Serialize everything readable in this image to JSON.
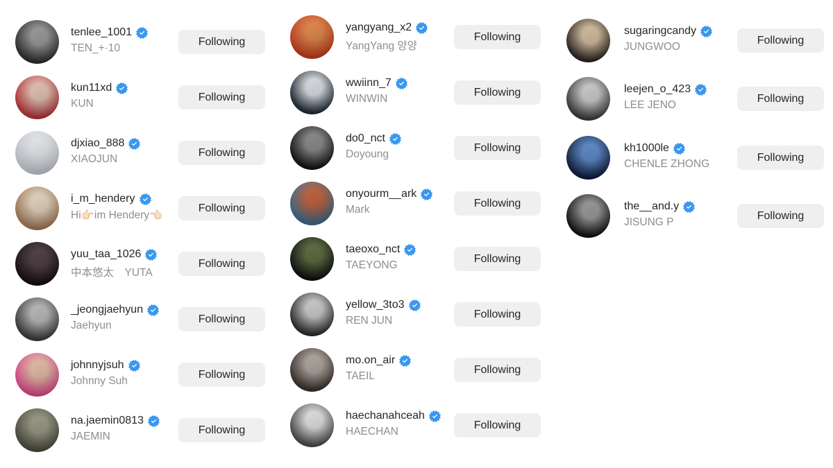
{
  "following_list": {
    "button_label": "Following",
    "verified_icon_color": "#3897f0",
    "columns": [
      {
        "accounts": [
          {
            "username": "tenlee_1001",
            "full_name": "TEN_+·10",
            "avatar": "avatar-photo",
            "tone": [
              "#2b2b2b",
              "#9a9a9a"
            ]
          },
          {
            "username": "kun11xd",
            "full_name": "KUN",
            "avatar": "avatar-photo",
            "tone": [
              "#b8323a",
              "#e8c6b4"
            ]
          },
          {
            "username": "djxiao_888",
            "full_name": "XIAOJUN",
            "avatar": "avatar-photo",
            "tone": [
              "#c8ccd4",
              "#eef0f3"
            ]
          },
          {
            "username": "i_m_hendery",
            "full_name": "Hi👉🏻im Hendery👈🏻",
            "avatar": "avatar-photo",
            "tone": [
              "#a47a56",
              "#e9d9c3"
            ]
          },
          {
            "username": "yuu_taa_1026",
            "full_name": "中本悠太　YUTA",
            "avatar": "avatar-photo",
            "tone": [
              "#120a0c",
              "#4a3a3e"
            ]
          },
          {
            "username": "_jeongjaehyun",
            "full_name": "Jaehyun",
            "avatar": "avatar-photo",
            "tone": [
              "#3a3a3a",
              "#bdbdbd"
            ]
          },
          {
            "username": "johnnyjsuh",
            "full_name": "Johnny Suh",
            "avatar": "avatar-photo",
            "tone": [
              "#e0488c",
              "#e8c0a8"
            ]
          },
          {
            "username": "na.jaemin0813",
            "full_name": "JAEMIN",
            "avatar": "avatar-photo",
            "tone": [
              "#4a4a3a",
              "#9a9a88"
            ]
          }
        ]
      },
      {
        "accounts": [
          {
            "username": "yangyang_x2",
            "full_name": "YangYang 양양",
            "avatar": "avatar-photo",
            "tone": [
              "#c23a1a",
              "#e8884a"
            ]
          },
          {
            "username": "wwiinn_7",
            "full_name": "WINWIN",
            "avatar": "avatar-photo",
            "tone": [
              "#1e2a36",
              "#dfe4e8"
            ]
          },
          {
            "username": "do0_nct",
            "full_name": "Doyoung",
            "avatar": "avatar-photo",
            "tone": [
              "#101010",
              "#8a8a8a"
            ]
          },
          {
            "username": "onyourm__ark",
            "full_name": "Mark",
            "avatar": "avatar-photo",
            "tone": [
              "#3a6a8a",
              "#c0603a"
            ]
          },
          {
            "username": "taeoxo_nct",
            "full_name": "TAEYONG",
            "avatar": "avatar-photo",
            "tone": [
              "#0c0c0c",
              "#5a6a3a"
            ]
          },
          {
            "username": "yellow_3to3",
            "full_name": "REN JUN",
            "avatar": "avatar-photo",
            "tone": [
              "#2a2a2a",
              "#cfcfcf"
            ]
          },
          {
            "username": "mo.on_air",
            "full_name": "TAEIL",
            "avatar": "avatar-photo",
            "tone": [
              "#3a2e2a",
              "#b0a8a0"
            ]
          },
          {
            "username": "haechanahceah",
            "full_name": "HAECHAN",
            "avatar": "avatar-photo",
            "tone": [
              "#4a4a4a",
              "#e6e6e6"
            ]
          }
        ]
      },
      {
        "accounts": [
          {
            "username": "sugaringcandy",
            "full_name": "JUNGWOO",
            "avatar": "avatar-photo",
            "tone": [
              "#2a2420",
              "#d8c0a0"
            ]
          },
          {
            "username": "leejen_o_423",
            "full_name": "LEE JENO",
            "avatar": "avatar-photo",
            "tone": [
              "#3a3a3a",
              "#d0d0d0"
            ]
          },
          {
            "username": "kh1000le",
            "full_name": "CHENLE ZHONG",
            "avatar": "avatar-photo",
            "tone": [
              "#0a1a3a",
              "#5a8acc"
            ]
          },
          {
            "username": "the__and.y",
            "full_name": "JISUNG P",
            "avatar": "avatar-photo",
            "tone": [
              "#0e0e0e",
              "#9a9a9a"
            ]
          }
        ]
      }
    ]
  }
}
